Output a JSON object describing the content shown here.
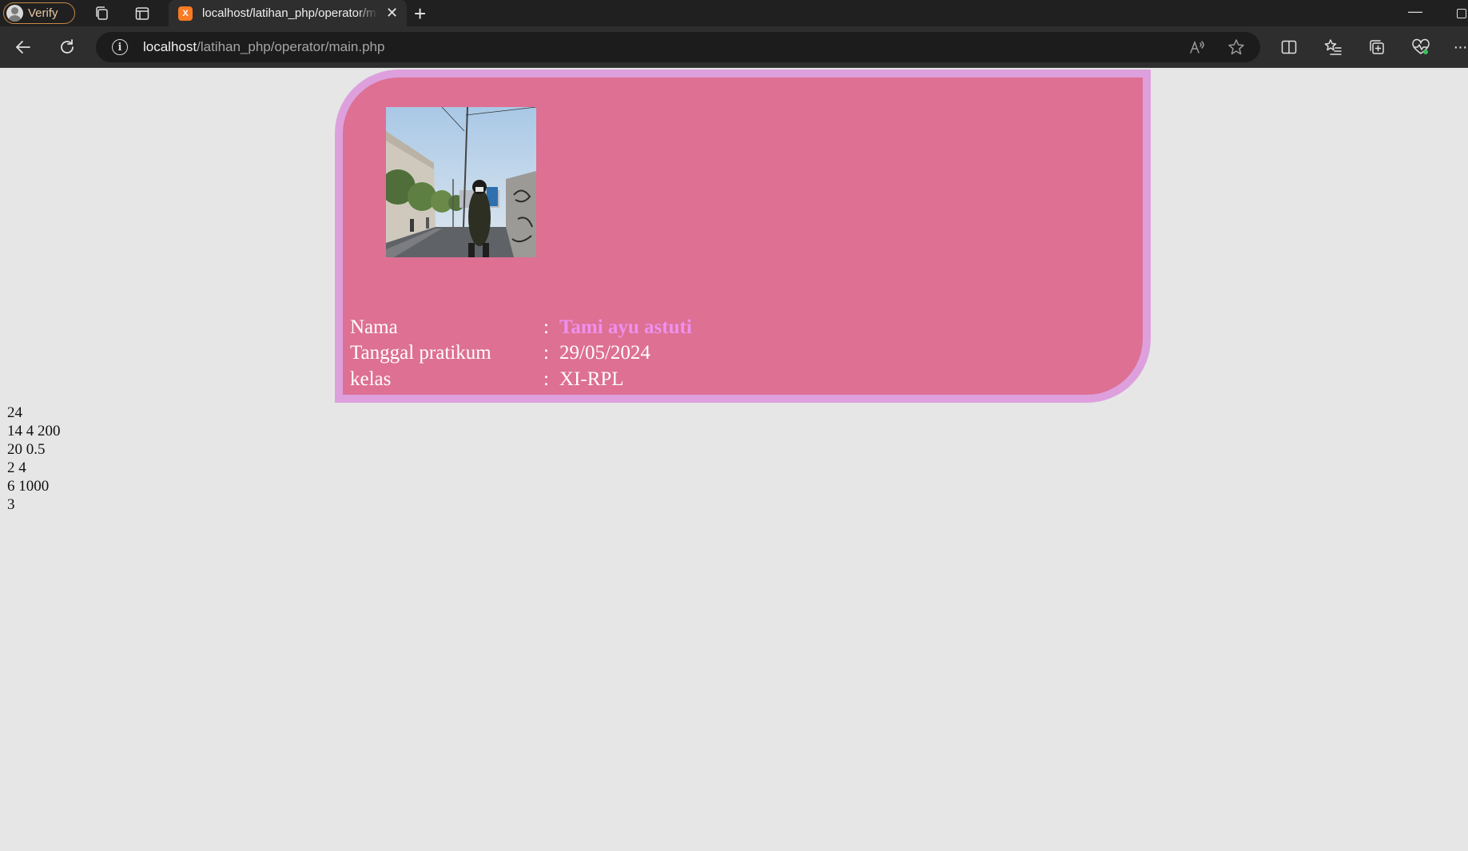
{
  "browser": {
    "profile_label": "Verify",
    "tab": {
      "favicon_text": "X",
      "title": "localhost/latihan_php/operator/main.php"
    },
    "address": {
      "host": "localhost",
      "path": "/latihan_php/operator/main.php"
    }
  },
  "card": {
    "photo_alt": "Foto profil",
    "rows": [
      {
        "label": "Nama",
        "colon": ":",
        "value": "Tami ayu astuti"
      },
      {
        "label": "Tanggal pratikum",
        "colon": ":",
        "value": "29/05/2024"
      },
      {
        "label": "kelas",
        "colon": ":",
        "value": "XI-RPL"
      }
    ]
  },
  "results": [
    "24",
    "14 4 200",
    "20 0.5",
    "2 4",
    "6 1000",
    "3"
  ],
  "colors": {
    "page_bg": "#e6e6e6",
    "card_bg": "#dd7093",
    "card_border": "#dda0dd",
    "name_color": "#ee90ee"
  }
}
